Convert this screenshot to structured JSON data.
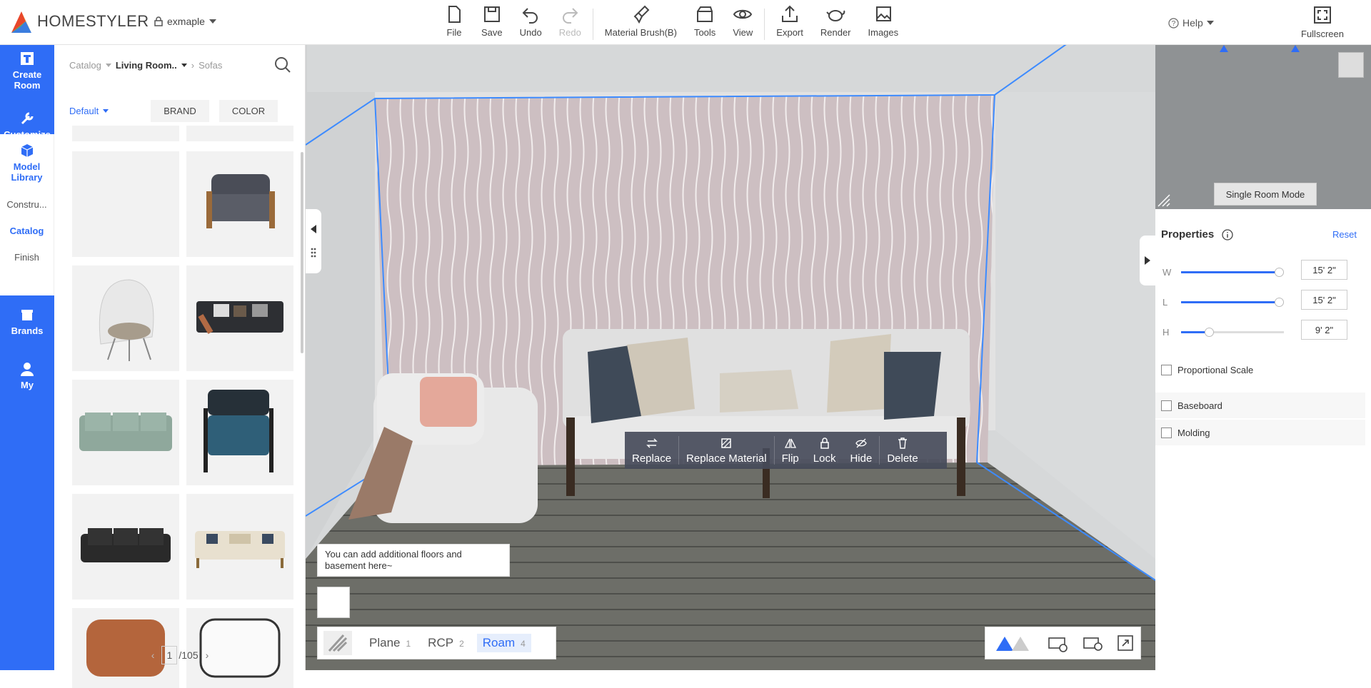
{
  "app": {
    "brand": "HOMESTYLER",
    "account": "exmaple"
  },
  "toolbar": {
    "file": "File",
    "save": "Save",
    "undo": "Undo",
    "redo": "Redo",
    "brush": "Material Brush(B)",
    "tools": "Tools",
    "view": "View",
    "export": "Export",
    "render": "Render",
    "images": "Images"
  },
  "help": "Help",
  "fullscreen": "Fullscreen",
  "leftnav": {
    "create_room": "Create Room",
    "customize": "Customize",
    "model_library": "Model Library",
    "brands": "Brands",
    "my": "My"
  },
  "subnav": {
    "construct": "Constru...",
    "catalog": "Catalog",
    "finish": "Finish"
  },
  "catalog": {
    "crumb_root": "Catalog",
    "crumb_mid": "Living Room..",
    "crumb_leaf": "Sofas",
    "sort": "Default",
    "brand_filter": "BRAND",
    "color_filter": "COLOR",
    "page": "1",
    "total_pages": "/105"
  },
  "tip": "You can add additional floors and basement here~",
  "levels": {
    "plane": "Plane",
    "plane_num": "1",
    "rcp": "RCP",
    "rcp_num": "2",
    "roam": "Roam",
    "roam_num": "4"
  },
  "context": {
    "replace": "Replace",
    "replace_material": "Replace Material",
    "flip": "Flip",
    "lock": "Lock",
    "hide": "Hide",
    "delete": "Delete"
  },
  "single_room_mode": "Single Room Mode",
  "properties": {
    "title": "Properties",
    "reset": "Reset",
    "w_label": "W",
    "w_value": "15' 2\"",
    "w_fraction": 0.95,
    "l_label": "L",
    "l_value": "15' 2\"",
    "l_fraction": 0.95,
    "h_label": "H",
    "h_value": "9' 2\"",
    "h_fraction": 0.27,
    "proportional": "Proportional Scale",
    "baseboard": "Baseboard",
    "molding": "Molding"
  },
  "colors": {
    "accent": "#2f6df6",
    "wall": "#cdbfc2",
    "floor": "#6a6c68"
  }
}
